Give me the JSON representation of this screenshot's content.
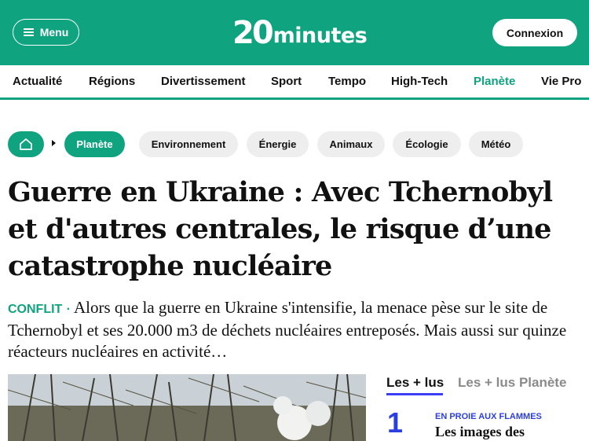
{
  "header": {
    "menu_label": "Menu",
    "logo_number": "20",
    "logo_word": "minutes",
    "login_label": "Connexion",
    "brand_color": "#0fa37f"
  },
  "nav": {
    "items": [
      "Actualité",
      "Régions",
      "Divertissement",
      "Sport",
      "Tempo",
      "High-Tech",
      "Planète",
      "Vie Pro"
    ],
    "active": "Planète"
  },
  "breadcrumb": {
    "home_icon": "home-icon",
    "current": "Planète",
    "tags": [
      "Environnement",
      "Énergie",
      "Animaux",
      "Écologie",
      "Météo"
    ]
  },
  "article": {
    "headline": "Guerre en Ukraine : Avec Tchernobyl et d'autres centrales, le risque d’une catastrophe nucléaire",
    "kicker": "CONFLIT",
    "separator": "·",
    "lead": "Alors que la guerre en Ukraine s'intensifie, la menace pèse sur le site de Tchernobyl et ses 20.000 m3 de déchets nucléaires entreposés. Mais aussi sur quinze réacteurs nucléaires en activité…"
  },
  "sidebar": {
    "tabs": [
      "Les + lus",
      "Les + lus Planète"
    ],
    "active_tab": "Les + lus",
    "items": [
      {
        "rank": "1",
        "kicker": "EN PROIE AUX FLAMMES",
        "title": "Les images des"
      }
    ]
  }
}
